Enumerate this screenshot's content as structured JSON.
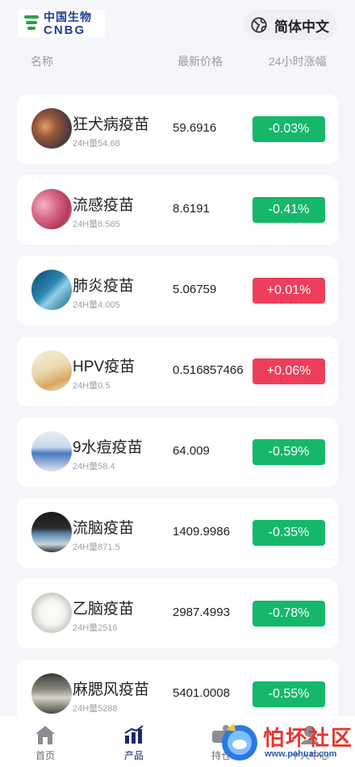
{
  "header": {
    "logo": {
      "cn": "中国生物",
      "en": "CNBG"
    },
    "language": {
      "label": "简体中文",
      "icon": "globe-icon"
    }
  },
  "columns": {
    "name": "名称",
    "price": "最新价格",
    "change": "24小时涨幅"
  },
  "products": [
    {
      "name": "狂犬病疫苗",
      "volume": "24H量54.68",
      "price": "59.6916",
      "change": "-0.03%",
      "direction": "down"
    },
    {
      "name": "流感疫苗",
      "volume": "24H量8.585",
      "price": "8.6191",
      "change": "-0.41%",
      "direction": "down"
    },
    {
      "name": "肺炎疫苗",
      "volume": "24H量4.005",
      "price": "5.06759",
      "change": "+0.01%",
      "direction": "up"
    },
    {
      "name": "HPV疫苗",
      "volume": "24H量0.5",
      "price": "0.516857466",
      "change": "+0.06%",
      "direction": "up"
    },
    {
      "name": "9水痘疫苗",
      "volume": "24H量58.4",
      "price": "64.009",
      "change": "-0.59%",
      "direction": "down"
    },
    {
      "name": "流脑疫苗",
      "volume": "24H量871.5",
      "price": "1409.9986",
      "change": "-0.35%",
      "direction": "down"
    },
    {
      "name": "乙脑疫苗",
      "volume": "24H量2516",
      "price": "2987.4993",
      "change": "-0.78%",
      "direction": "down"
    },
    {
      "name": "麻腮风疫苗",
      "volume": "24H量5288",
      "price": "5401.0008",
      "change": "-0.55%",
      "direction": "down"
    }
  ],
  "tabbar": [
    {
      "label": "首页",
      "icon": "home-icon"
    },
    {
      "label": "产品",
      "icon": "bar-chart-icon",
      "active": true
    },
    {
      "label": "持仓",
      "icon": "wallet-icon"
    },
    {
      "label": "个人中心",
      "icon": "user-icon"
    }
  ],
  "watermark": {
    "text": "怕坏社区",
    "url": "www.pahuai.com"
  },
  "colors": {
    "down": "#15b86a",
    "up": "#ef3e5c",
    "background": "#f5f6fa"
  }
}
